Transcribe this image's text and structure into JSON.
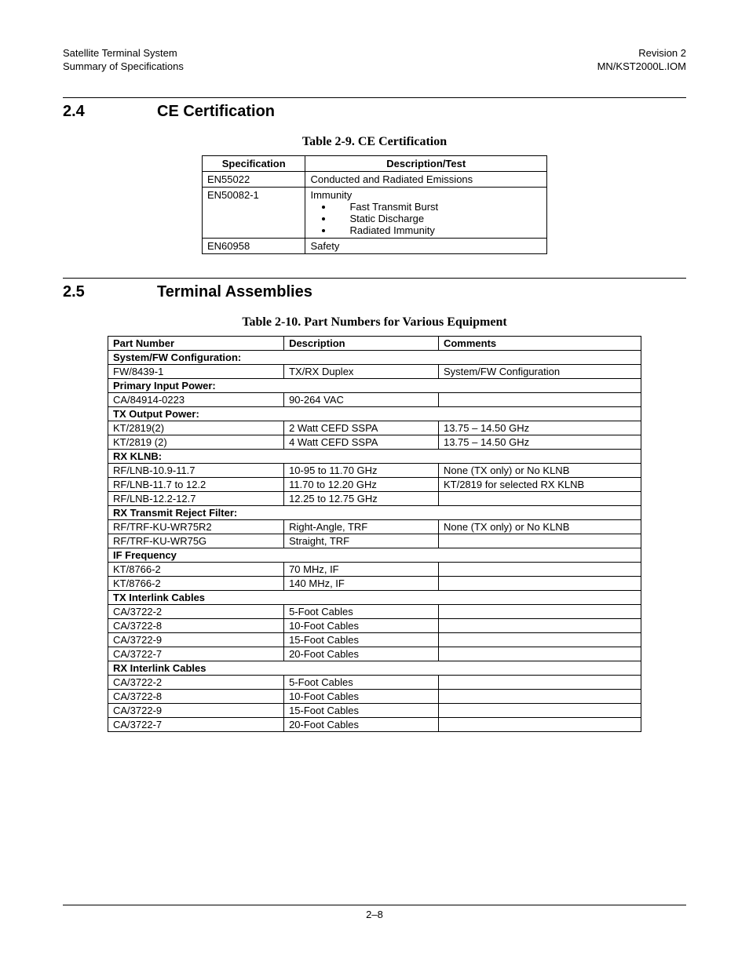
{
  "header": {
    "left_line1": "Satellite Terminal System",
    "left_line2": "Summary of Specifications",
    "right_line1": "Revision 2",
    "right_line2": "MN/KST2000L.IOM"
  },
  "section24": {
    "number": "2.4",
    "title": "CE Certification",
    "table_caption": "Table 2-9.  CE Certification",
    "headers": {
      "spec": "Specification",
      "desc": "Description/Test"
    },
    "rows": [
      {
        "spec": "EN55022",
        "desc_text": "Conducted and Radiated Emissions",
        "bullets": []
      },
      {
        "spec": "EN50082-1",
        "desc_text": "Immunity",
        "bullets": [
          "Fast Transmit Burst",
          "Static Discharge",
          "Radiated Immunity"
        ]
      },
      {
        "spec": "EN60958",
        "desc_text": "Safety",
        "bullets": []
      }
    ]
  },
  "section25": {
    "number": "2.5",
    "title": "Terminal Assemblies",
    "table_caption": "Table 2-10.  Part Numbers for Various Equipment",
    "headers": {
      "pn": "Part Number",
      "desc": "Description",
      "com": "Comments"
    },
    "groups": [
      {
        "label": "System/FW Configuration:",
        "rows": [
          {
            "pn": "FW/8439-1",
            "desc": "TX/RX Duplex",
            "com": "System/FW Configuration"
          }
        ]
      },
      {
        "label": "Primary Input Power:",
        "rows": [
          {
            "pn": "CA/84914-0223",
            "desc": "90-264 VAC",
            "com": ""
          }
        ]
      },
      {
        "label": "TX Output Power:",
        "rows": [
          {
            "pn": "KT/2819(2)",
            "desc": "2 Watt CEFD SSPA",
            "com": "13.75 – 14.50 GHz"
          },
          {
            "pn": "KT/2819 (2)",
            "desc": "4 Watt CEFD SSPA",
            "com": "13.75 – 14.50 GHz"
          }
        ]
      },
      {
        "label": "RX KLNB:",
        "rows": [
          {
            "pn": "RF/LNB-10.9-11.7",
            "desc": "10-95 to 11.70 GHz",
            "com": "None (TX only) or No KLNB"
          },
          {
            "pn": "RF/LNB-11.7 to 12.2",
            "desc": "11.70 to 12.20 GHz",
            "com": "KT/2819 for selected RX KLNB"
          },
          {
            "pn": "RF/LNB-12.2-12.7",
            "desc": "12.25 to 12.75 GHz",
            "com": ""
          }
        ]
      },
      {
        "label": "RX Transmit Reject Filter:",
        "rows": [
          {
            "pn": "RF/TRF-KU-WR75R2",
            "desc": "Right-Angle, TRF",
            "com": "None (TX only) or No KLNB"
          },
          {
            "pn": "RF/TRF-KU-WR75G",
            "desc": "Straight, TRF",
            "com": ""
          }
        ]
      },
      {
        "label": "IF Frequency",
        "rows": [
          {
            "pn": "KT/8766-2",
            "desc": "70 MHz, IF",
            "com": ""
          },
          {
            "pn": "KT/8766-2",
            "desc": "140 MHz, IF",
            "com": ""
          }
        ]
      },
      {
        "label": "TX Interlink Cables",
        "rows": [
          {
            "pn": "CA/3722-2",
            "desc": "5-Foot Cables",
            "com": ""
          },
          {
            "pn": "CA/3722-8",
            "desc": "10-Foot Cables",
            "com": ""
          },
          {
            "pn": "CA/3722-9",
            "desc": "15-Foot Cables",
            "com": ""
          },
          {
            "pn": "CA/3722-7",
            "desc": "20-Foot Cables",
            "com": ""
          }
        ]
      },
      {
        "label": "RX Interlink Cables",
        "rows": [
          {
            "pn": "CA/3722-2",
            "desc": "5-Foot Cables",
            "com": ""
          },
          {
            "pn": "CA/3722-8",
            "desc": "10-Foot Cables",
            "com": ""
          },
          {
            "pn": "CA/3722-9",
            "desc": "15-Foot Cables",
            "com": ""
          },
          {
            "pn": "CA/3722-7",
            "desc": "20-Foot Cables",
            "com": ""
          }
        ]
      }
    ]
  },
  "footer": {
    "page": "2–8"
  }
}
